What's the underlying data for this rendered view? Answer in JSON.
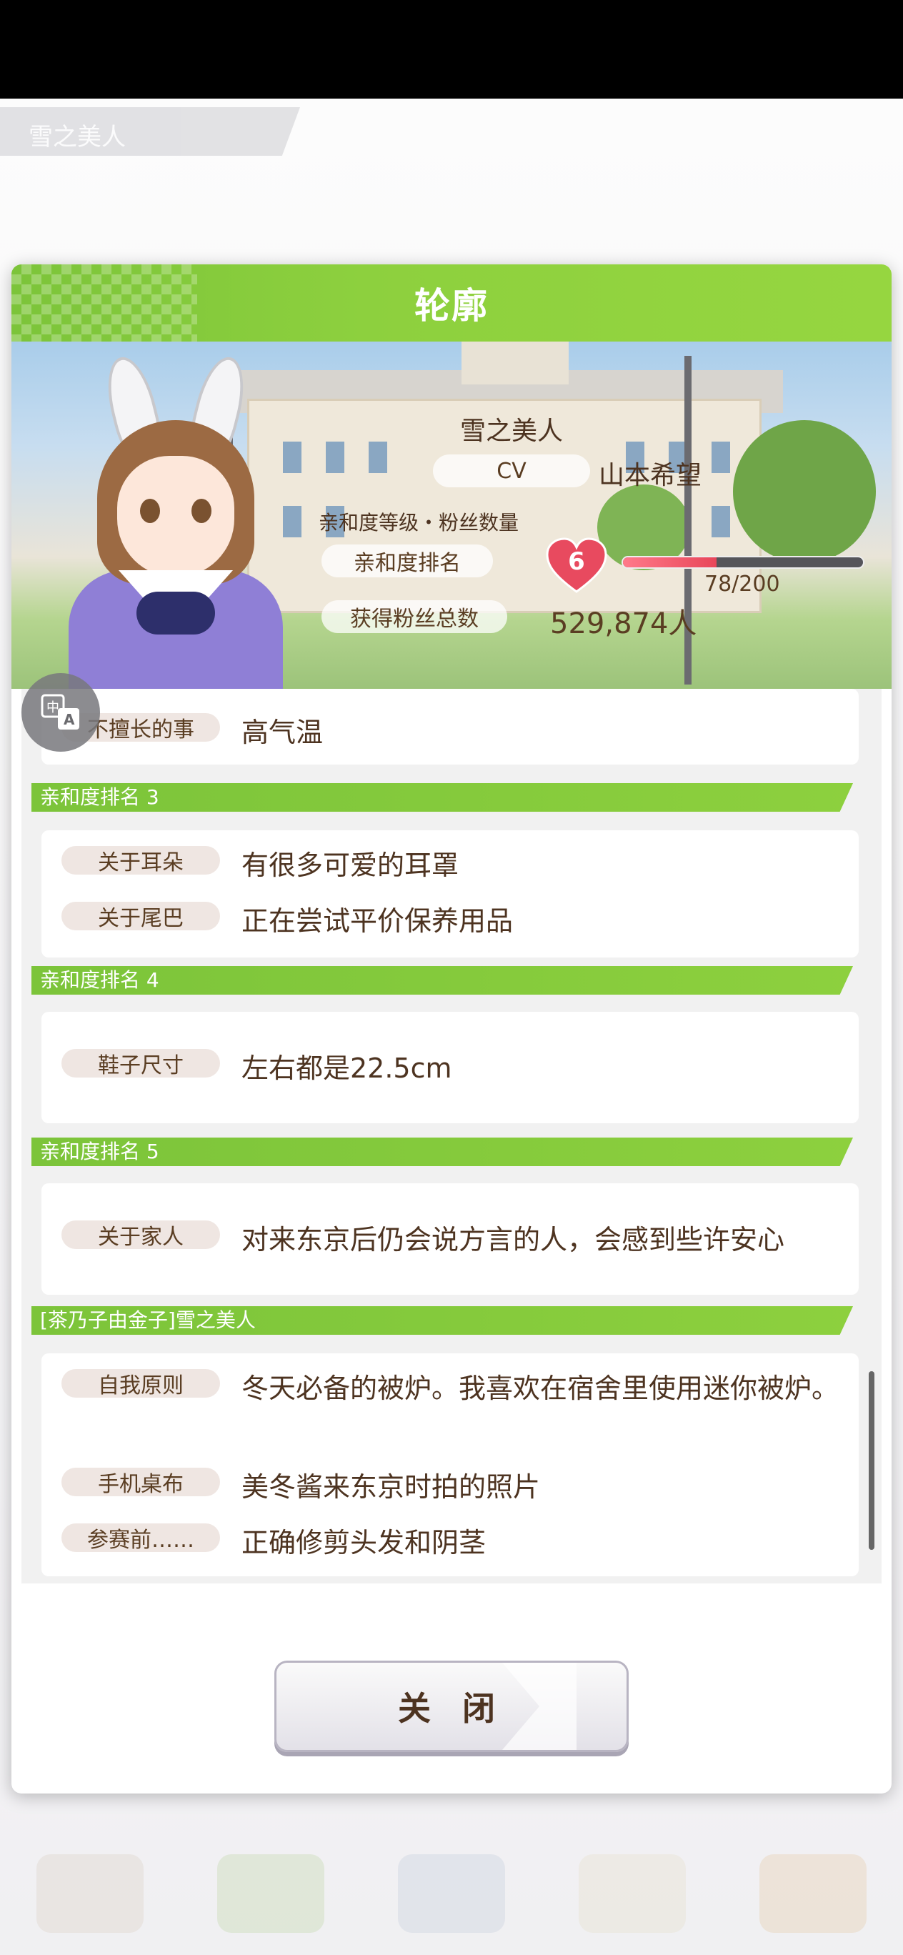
{
  "background": {
    "tag_text": "雪之美人",
    "nav_items": [
      "",
      "",
      "",
      "",
      ""
    ]
  },
  "dialog": {
    "title": "轮廓",
    "character": {
      "name": "雪之美人",
      "cv_label": "CV",
      "cv_name": "山本希望",
      "affinity_caption": "亲和度等级・粉丝数量",
      "affinity_rank_label": "亲和度排名",
      "affinity_level": "6",
      "affinity_progress_text": "78/200",
      "affinity_progress_fraction": 0.39,
      "fans_label": "获得粉丝总数",
      "fans_count": "529,874人"
    },
    "profile": {
      "partial_row": {
        "label": "不擅长的事",
        "value": "高气温"
      },
      "sections": [
        {
          "title": "亲和度排名 3",
          "rows": [
            {
              "label": "关于耳朵",
              "value": "有很多可爱的耳罩"
            },
            {
              "label": "关于尾巴",
              "value": "正在尝试平价保养用品"
            }
          ]
        },
        {
          "title": "亲和度排名 4",
          "rows": [
            {
              "label": "鞋子尺寸",
              "value": "左右都是22.5cm"
            }
          ]
        },
        {
          "title": "亲和度排名 5",
          "rows": [
            {
              "label": "关于家人",
              "value": "对来东京后仍会说方言的人，会感到些许安心"
            }
          ]
        },
        {
          "title": "[茶乃子由金子]雪之美人",
          "rows": [
            {
              "label": "自我原则",
              "value": "冬天必备的被炉。我喜欢在宿舍里使用迷你被炉。"
            },
            {
              "label": "手机桌布",
              "value": "美冬酱来东京时拍的照片"
            },
            {
              "label": "参赛前……",
              "value": "正确修剪头发和阴茎"
            }
          ]
        }
      ]
    },
    "close_label": "关 闭"
  }
}
